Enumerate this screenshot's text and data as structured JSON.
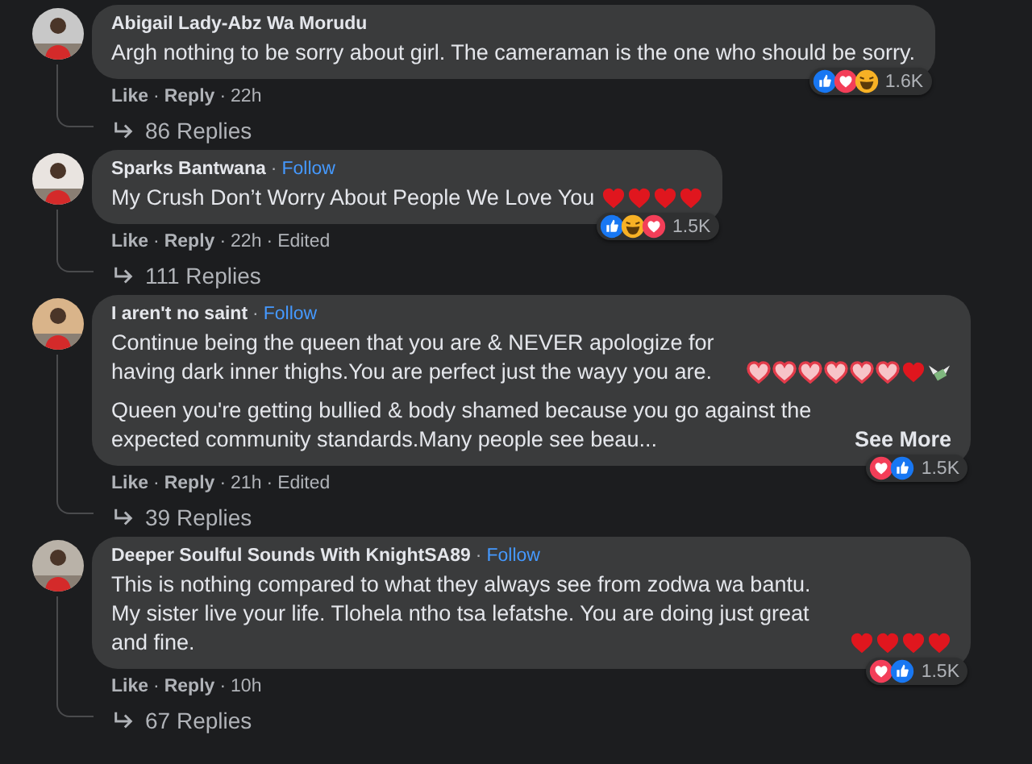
{
  "comments": [
    {
      "author": "Abigail Lady-Abz Wa Morudu",
      "paragraphs": [
        {
          "text": "Argh nothing to be sorry about girl. The cameraman is the one who should be sorry."
        }
      ],
      "reactions": [
        {
          "kind": "like"
        },
        {
          "kind": "love"
        },
        {
          "kind": "haha"
        }
      ],
      "reaction_count": "1.6K",
      "meta": [
        {
          "kind": "link",
          "text": "Like"
        },
        {
          "kind": "dot",
          "text": "·"
        },
        {
          "kind": "link",
          "text": "Reply"
        },
        {
          "kind": "dot",
          "text": "·"
        },
        {
          "kind": "time",
          "text": "22h"
        }
      ],
      "replies": "86 Replies"
    },
    {
      "author": "Sparks Bantwana",
      "follow": {
        "dot": "·",
        "text": "Follow"
      },
      "paragraphs": [
        {
          "text": "My Crush Don’t Worry About People We Love You",
          "emojis": [
            {
              "kind": "red-heart"
            },
            {
              "kind": "red-heart"
            },
            {
              "kind": "red-heart"
            },
            {
              "kind": "red-heart"
            }
          ]
        }
      ],
      "reactions": [
        {
          "kind": "like"
        },
        {
          "kind": "haha"
        },
        {
          "kind": "love"
        }
      ],
      "reaction_count": "1.5K",
      "meta": [
        {
          "kind": "link",
          "text": "Like"
        },
        {
          "kind": "dot",
          "text": "·"
        },
        {
          "kind": "link",
          "text": "Reply"
        },
        {
          "kind": "dot",
          "text": "·"
        },
        {
          "kind": "time",
          "text": "22h"
        },
        {
          "kind": "dot",
          "text": "·"
        },
        {
          "kind": "edited",
          "text": "Edited"
        }
      ],
      "replies": "111 Replies"
    },
    {
      "author": "I aren't no saint",
      "follow": {
        "dot": "·",
        "text": "Follow"
      },
      "paragraphs": [
        {
          "text": "Continue being the queen that you are & NEVER apologize for having dark inner thighs.You are perfect just the wayy you are.",
          "emojis": [
            {
              "kind": "pink-heart"
            },
            {
              "kind": "pink-heart"
            },
            {
              "kind": "pink-heart"
            },
            {
              "kind": "pink-heart"
            },
            {
              "kind": "pink-heart"
            },
            {
              "kind": "pink-heart"
            },
            {
              "kind": "red-heart"
            },
            {
              "kind": "money"
            }
          ]
        },
        {
          "text": "Queen you're getting bullied & body shamed because you go against the expected community standards.Many people see beau...",
          "see_more": "See More"
        }
      ],
      "reactions": [
        {
          "kind": "love"
        },
        {
          "kind": "like"
        }
      ],
      "reaction_count": "1.5K",
      "meta": [
        {
          "kind": "link",
          "text": "Like"
        },
        {
          "kind": "dot",
          "text": "·"
        },
        {
          "kind": "link",
          "text": "Reply"
        },
        {
          "kind": "dot",
          "text": "·"
        },
        {
          "kind": "time",
          "text": "21h"
        },
        {
          "kind": "dot",
          "text": "·"
        },
        {
          "kind": "edited",
          "text": "Edited"
        }
      ],
      "replies": "39 Replies"
    },
    {
      "author": "Deeper Soulful Sounds With KnightSA89",
      "follow": {
        "dot": "·",
        "text": "Follow"
      },
      "paragraphs": [
        {
          "text": "This is nothing compared to what they always see from zodwa wa bantu. My sister live your life. Tlohela ntho tsa lefatshe. You are doing just great and fine.",
          "emojis": [
            {
              "kind": "red-heart"
            },
            {
              "kind": "red-heart"
            },
            {
              "kind": "red-heart"
            },
            {
              "kind": "red-heart"
            }
          ]
        }
      ],
      "reactions": [
        {
          "kind": "love"
        },
        {
          "kind": "like"
        }
      ],
      "reaction_count": "1.5K",
      "meta": [
        {
          "kind": "link",
          "text": "Like"
        },
        {
          "kind": "dot",
          "text": "·"
        },
        {
          "kind": "link",
          "text": "Reply"
        },
        {
          "kind": "dot",
          "text": "·"
        },
        {
          "kind": "time",
          "text": "10h"
        }
      ],
      "replies": "67 Replies"
    }
  ]
}
